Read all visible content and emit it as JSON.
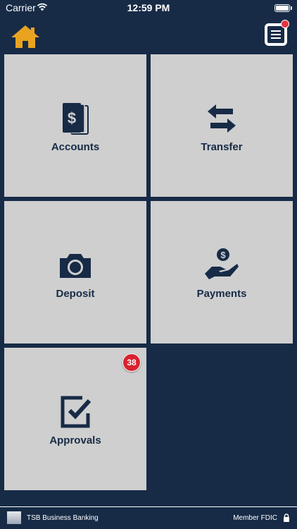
{
  "status_bar": {
    "carrier": "Carrier",
    "time": "12:59 PM"
  },
  "header": {
    "home_icon": "home-icon",
    "menu_icon": "menu-icon",
    "menu_has_notification": true
  },
  "tiles": [
    {
      "label": "Accounts",
      "icon": "money-cards-icon"
    },
    {
      "label": "Transfer",
      "icon": "transfer-arrows-icon"
    },
    {
      "label": "Deposit",
      "icon": "camera-icon"
    },
    {
      "label": "Payments",
      "icon": "hand-coin-icon"
    },
    {
      "label": "Approvals",
      "icon": "checkbox-icon",
      "badge": "38"
    }
  ],
  "footer": {
    "app_name": "TSB Business Banking",
    "fdic_text": "Member FDIC",
    "lock_icon": "lock-icon"
  },
  "colors": {
    "background": "#172b46",
    "tile": "#cfcfcf",
    "home_icon": "#e9a321",
    "badge": "#d8232f"
  }
}
